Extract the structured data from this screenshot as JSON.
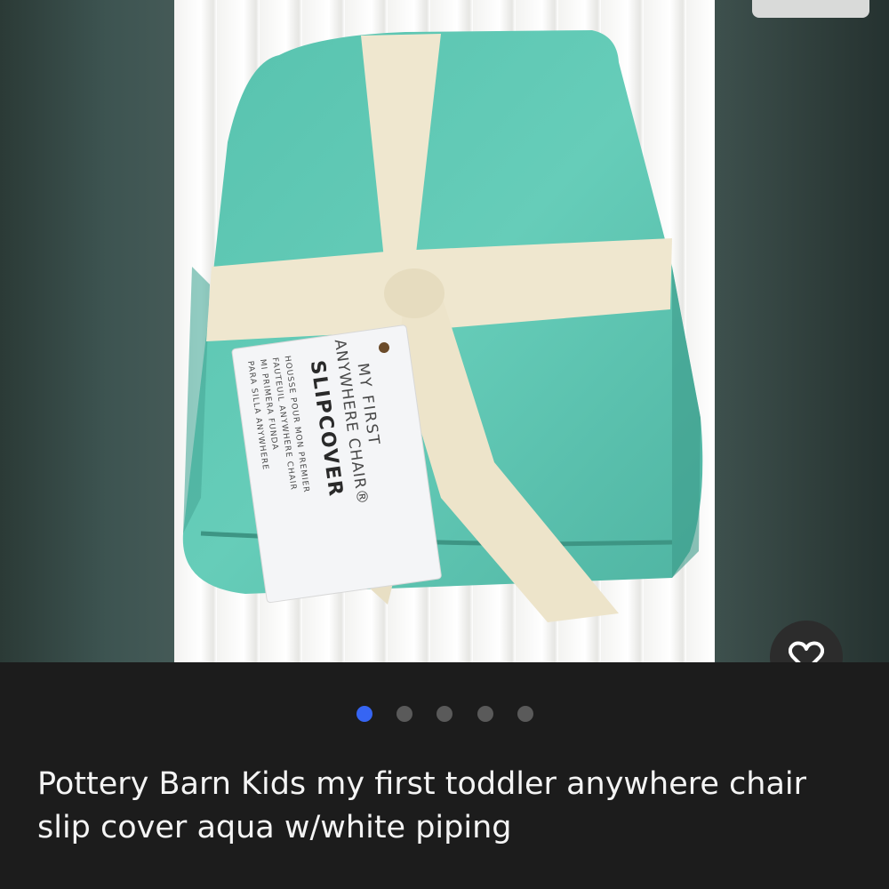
{
  "product": {
    "title": "Pottery Barn Kids my first toddler anywhere chair slip cover aqua w/white piping",
    "tag": {
      "line1": "MY FIRST",
      "line2": "ANYWHERE CHAIR®",
      "line3": "SLIPCOVER",
      "line4": "HOUSSE POUR MON PREMIER",
      "line5": "FAUTEUIL ANYWHERE CHAIR",
      "line6": "MI PRIMERA FUNDA",
      "line7": "PARA SILLA ANYWHERE"
    }
  },
  "gallery": {
    "image_count": 5,
    "active_index": 0
  },
  "icons": {
    "favorite": "heart-outline-icon"
  },
  "colors": {
    "accent": "#3665f3",
    "background": "#1c1c1c",
    "fabric": "#5dc7b4",
    "ribbon": "#efe7cf"
  }
}
